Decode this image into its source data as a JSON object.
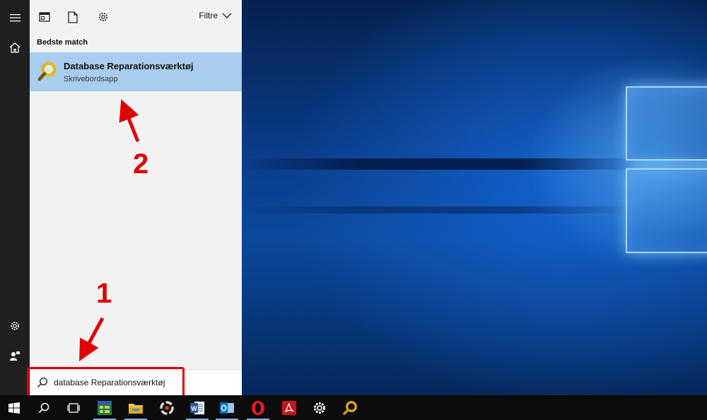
{
  "search_panel": {
    "filter_label": "Filtre",
    "section_label": "Bedste match",
    "best_match": {
      "title": "Database Reparationsværktøj",
      "subtitle": "Skrivebordsapp"
    },
    "search_value": "database Reparationsværktøj"
  },
  "rail": {
    "items": [
      "hamburger-icon",
      "home-icon",
      "settings-icon",
      "user-feedback-icon"
    ]
  },
  "taskbar": {
    "items": [
      "windows-start-icon",
      "search-icon",
      "task-view-icon",
      "spreadsheet-app-icon",
      "file-explorer-icon",
      "recovery-app-icon",
      "word-icon",
      "outlook-icon",
      "opera-icon",
      "pdf-reader-icon",
      "settings-gear-icon",
      "database-repair-tool-icon"
    ]
  },
  "annotations": {
    "step_one": "1",
    "step_two": "2",
    "color": "#e00000"
  },
  "colors": {
    "selection": "#a8cdee",
    "panel": "#f2f2f2",
    "rail": "#1f1f1f",
    "taskbar": "#0c0c0c"
  }
}
